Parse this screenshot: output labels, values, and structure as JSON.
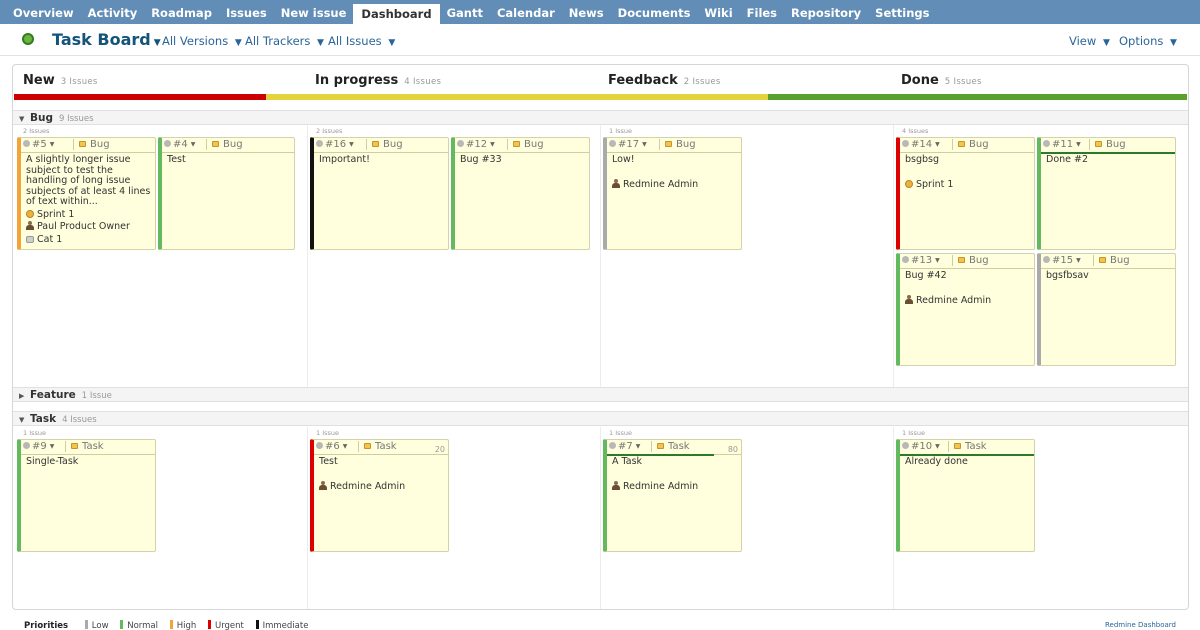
{
  "nav": {
    "tabs": [
      {
        "label": "Overview"
      },
      {
        "label": "Activity"
      },
      {
        "label": "Roadmap"
      },
      {
        "label": "Issues"
      },
      {
        "label": "New issue"
      },
      {
        "label": "Dashboard",
        "active": true
      },
      {
        "label": "Gantt"
      },
      {
        "label": "Calendar"
      },
      {
        "label": "News"
      },
      {
        "label": "Documents"
      },
      {
        "label": "Wiki"
      },
      {
        "label": "Files"
      },
      {
        "label": "Repository"
      },
      {
        "label": "Settings"
      }
    ]
  },
  "header": {
    "title": "Task Board",
    "versions": "All Versions",
    "trackers": "All Trackers",
    "issues": "All Issues",
    "view": "View",
    "options": "Options"
  },
  "columns": [
    {
      "name": "New",
      "count": "3 Issues",
      "color": "#cc0000"
    },
    {
      "name": "In progress",
      "count": "4 Issues",
      "color": "#e3d43b"
    },
    {
      "name": "Feedback",
      "count": "2 Issues",
      "color": "#e3d43b"
    },
    {
      "name": "Done",
      "count": "5 Issues",
      "color": "#5aa02c"
    }
  ],
  "lanes": {
    "bug": {
      "name": "Bug",
      "count": "9 Issues"
    },
    "feature": {
      "name": "Feature",
      "count": "1 Issue"
    },
    "task": {
      "name": "Task",
      "count": "4 Issues"
    }
  },
  "cell_counts": {
    "bug_new": "2 Issues",
    "bug_progress": "2 Issues",
    "bug_feedback": "1 Issue",
    "bug_done": "4 Issues",
    "task_new": "1 Issue",
    "task_progress": "1 Issue",
    "task_feedback": "1 Issue",
    "task_done": "1 Issue"
  },
  "cards": {
    "c5": {
      "id": "#5",
      "tracker": "Bug",
      "subject": "A slightly longer issue subject to test the handling of long issue subjects of at least 4 lines of text within...",
      "sprint": "Sprint 1",
      "assignee": "Paul Product Owner",
      "category": "Cat 1",
      "priority": "High"
    },
    "c4": {
      "id": "#4",
      "tracker": "Bug",
      "subject": "Test",
      "priority": "Normal"
    },
    "c16": {
      "id": "#16",
      "tracker": "Bug",
      "subject": "Important!",
      "priority": "Immediate"
    },
    "c12": {
      "id": "#12",
      "tracker": "Bug",
      "subject": "Bug #33",
      "priority": "Normal"
    },
    "c17": {
      "id": "#17",
      "tracker": "Bug",
      "subject": "Low!",
      "assignee": "Redmine Admin",
      "priority": "Low"
    },
    "c14": {
      "id": "#14",
      "tracker": "Bug",
      "subject": "bsgbsg",
      "sprint": "Sprint 1",
      "priority": "Urgent"
    },
    "c11": {
      "id": "#11",
      "tracker": "Bug",
      "subject": "Done #2",
      "priority": "Normal",
      "done_ratio": 1.0
    },
    "c13": {
      "id": "#13",
      "tracker": "Bug",
      "subject": "Bug #42",
      "assignee": "Redmine Admin",
      "priority": "Normal"
    },
    "c15": {
      "id": "#15",
      "tracker": "Bug",
      "subject": "bgsfbsav",
      "priority": "Low"
    },
    "c9": {
      "id": "#9",
      "tracker": "Task",
      "subject": "Single-Task",
      "priority": "Normal"
    },
    "c6": {
      "id": "#6",
      "tracker": "Task",
      "subject": "Test",
      "assignee": "Redmine Admin",
      "estimate": "20",
      "priority": "Urgent"
    },
    "c7": {
      "id": "#7",
      "tracker": "Task",
      "subject": "A Task",
      "assignee": "Redmine Admin",
      "estimate": "80",
      "priority": "Normal",
      "done_ratio": 0.8
    },
    "c10": {
      "id": "#10",
      "tracker": "Task",
      "subject": "Already done",
      "priority": "Normal",
      "done_ratio": 1.0
    }
  },
  "priority_colors": {
    "Low": "#aaaaaa",
    "Normal": "#63b95d",
    "High": "#f4a23a",
    "Urgent": "#dd0000",
    "Immediate": "#111111"
  },
  "legend": {
    "title": "Priorities",
    "items": [
      "Low",
      "Normal",
      "High",
      "Urgent",
      "Immediate"
    ]
  },
  "footer_link": "Redmine Dashboard"
}
